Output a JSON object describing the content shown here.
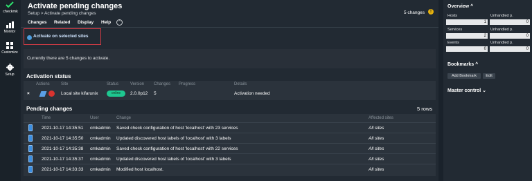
{
  "nav": {
    "logo_text": "checkmk",
    "items": [
      {
        "label": "Monitor"
      },
      {
        "label": "Customize"
      },
      {
        "label": "Setup"
      }
    ]
  },
  "header": {
    "title": "Activate pending changes",
    "breadcrumb": "Setup > Activate pending changes",
    "changes_count": "5 changes",
    "warn_icon": "!"
  },
  "menu": [
    "Changes",
    "Related",
    "Display",
    "Help"
  ],
  "menu_toggle": "^",
  "action": {
    "activate_label": "Activate on selected sites"
  },
  "info": "Currently there are 5 changes to activate.",
  "activation": {
    "title": "Activation status",
    "columns": [
      "Actions",
      "Site",
      "Status",
      "Version",
      "Changes",
      "Progress",
      "Details"
    ],
    "row": {
      "close": "×",
      "site": "Local site kifarunix",
      "status": "online",
      "version": "2.0.0p12",
      "changes": "5",
      "details": "Activation needed"
    }
  },
  "pending": {
    "title": "Pending changes",
    "rows_count": "5 rows",
    "columns": [
      "Time",
      "User",
      "Change",
      "Affected sites"
    ],
    "rows": [
      {
        "time": "2021-10-17 14:35:51",
        "user": "cmkadmin",
        "change": "Saved check configuration of host 'localhost' with 23 services",
        "sites": "All sites"
      },
      {
        "time": "2021-10-17 14:35:50",
        "user": "cmkadmin",
        "change": "Updated discovered host labels of 'localhost' with 3 labels",
        "sites": "All sites"
      },
      {
        "time": "2021-10-17 14:35:38",
        "user": "cmkadmin",
        "change": "Saved check configuration of host 'localhost' with 22 services",
        "sites": "All sites"
      },
      {
        "time": "2021-10-17 14:35:37",
        "user": "cmkadmin",
        "change": "Updated discovered host labels of 'localhost' with 3 labels",
        "sites": "All sites"
      },
      {
        "time": "2021-10-17 14:33:33",
        "user": "cmkadmin",
        "change": "Modified host localhost.",
        "sites": "All sites"
      }
    ]
  },
  "sidebar": {
    "overview": {
      "title": "Overview ^",
      "rows": [
        {
          "label": "Hosts",
          "value": "1",
          "unhandled_label": "Unhandled p.",
          "unhandled": "0"
        },
        {
          "label": "Services",
          "value": "2",
          "unhandled_label": "Unhandled p.",
          "unhandled": "0"
        },
        {
          "label": "Events",
          "value": "0",
          "unhandled_label": "Unhandled p.",
          "unhandled": "0"
        }
      ]
    },
    "bookmarks": {
      "title": "Bookmarks ^",
      "add_label": "Add Bookmark",
      "edit_label": "Edit"
    },
    "master": {
      "title": "Master control ⌄"
    }
  },
  "colors": {
    "accent": "#1ec790",
    "warning": "#e6b20e",
    "highlight_border": "#d23b45"
  }
}
